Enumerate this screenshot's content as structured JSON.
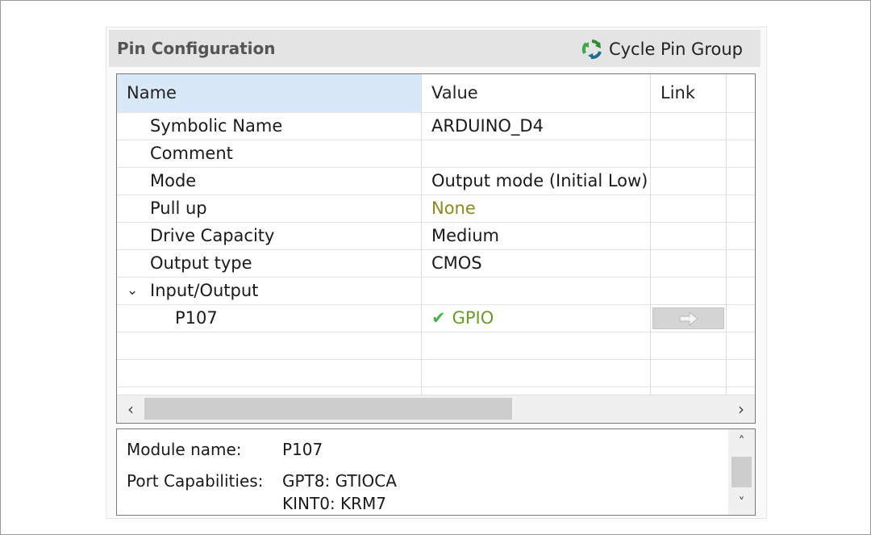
{
  "panel": {
    "title": "Pin Configuration",
    "cycle_label": "Cycle Pin Group",
    "cycle_icon": "cycle-arrows-icon"
  },
  "table": {
    "columns": [
      "Name",
      "Value",
      "Link"
    ],
    "rows": [
      {
        "name": "Symbolic Name",
        "value": "ARDUINO_D4"
      },
      {
        "name": "Comment",
        "value": ""
      },
      {
        "name": "Mode",
        "value": "Output mode (Initial Low)"
      },
      {
        "name": "Pull up",
        "value": "None"
      },
      {
        "name": "Drive Capacity",
        "value": "Medium"
      },
      {
        "name": "Output type",
        "value": "CMOS"
      },
      {
        "name": "Input/Output",
        "value": ""
      },
      {
        "name": "P107",
        "value": "GPIO"
      }
    ]
  },
  "colors": {
    "header_selected": "#d9e8f7",
    "pullup_value": "#8a8a1e",
    "gpio_value": "#6b9a2a",
    "check": "#4caf50"
  },
  "info": {
    "module_label": "Module name:",
    "module_value": "P107",
    "caps_label": "Port Capabilities:",
    "caps_line1": "GPT8: GTIOCA",
    "caps_line2": "KINT0: KRM7"
  }
}
